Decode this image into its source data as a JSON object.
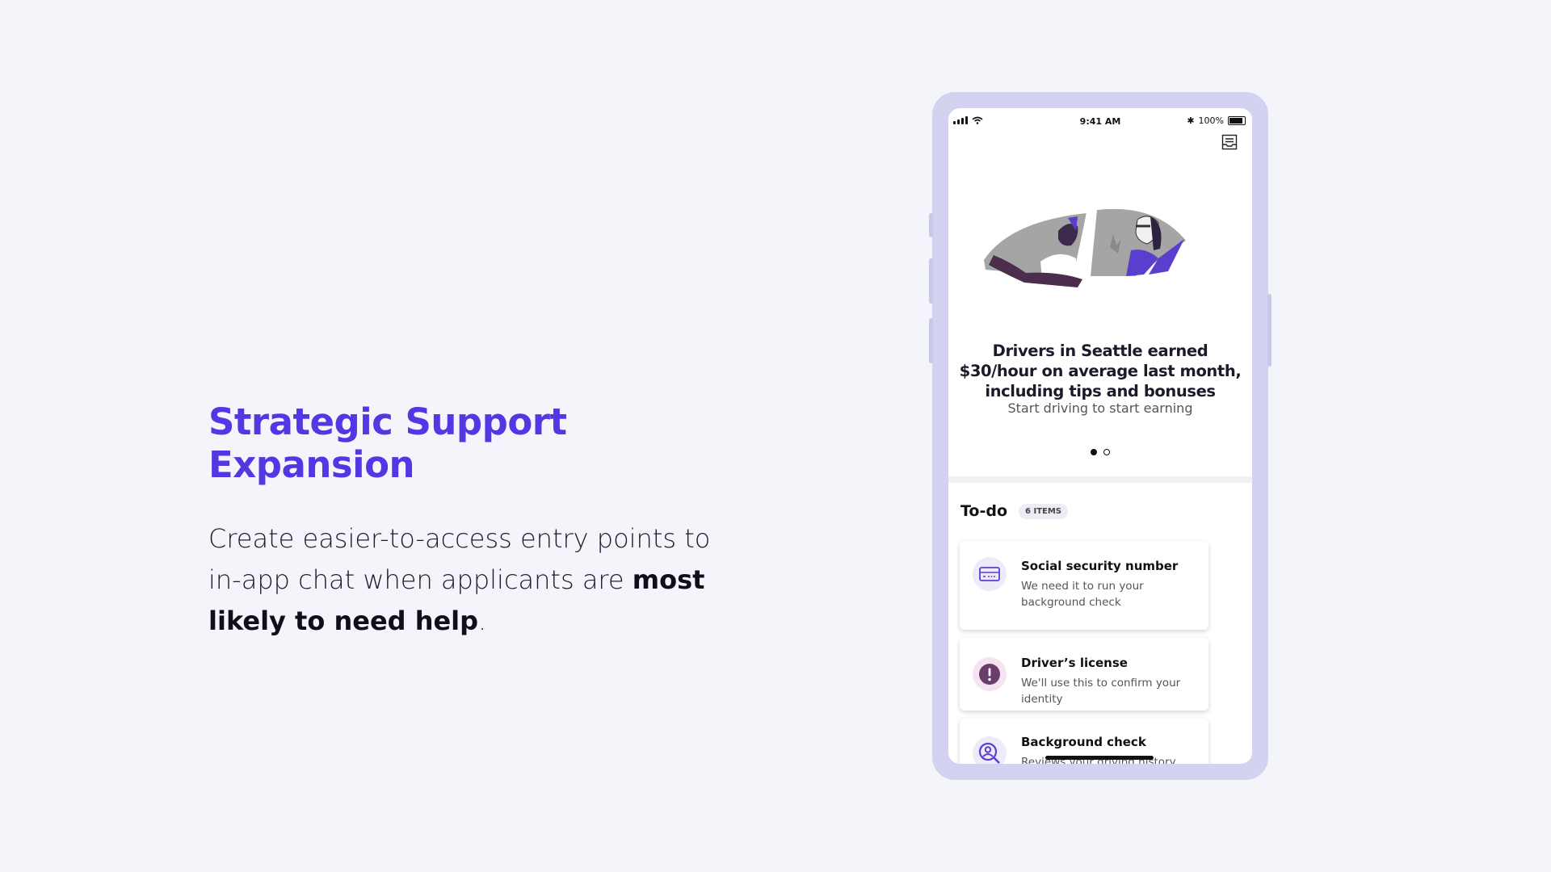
{
  "slide": {
    "headline": "Strategic Support Expansion",
    "body_part1": "Create easier-to-access entry points to in-app chat when applicants are ",
    "body_bold": "most likely to need help",
    "body_part2": "."
  },
  "phone": {
    "status": {
      "time": "9:41 AM",
      "battery": "100%"
    },
    "promo": {
      "title": "Drivers in Seattle earned $30/hour on average last month, including tips and bonuses",
      "subtitle": "Start driving to start earning",
      "pages": 2,
      "active_page": 1
    },
    "todo": {
      "title": "To-do",
      "badge": "6 ITEMS",
      "items": [
        {
          "title": "Social security number",
          "desc": "We need it to run your background check",
          "icon": "id-card-icon"
        },
        {
          "title": "Driver’s license",
          "desc": "We'll use this to confirm your identity",
          "icon": "alert-icon"
        },
        {
          "title": "Background check",
          "desc": "Reviews your driving history and",
          "icon": "search-person-icon"
        }
      ]
    }
  },
  "colors": {
    "accent": "#5238e3",
    "frame": "#d3d2f0",
    "purple": "#5a3fcf"
  }
}
